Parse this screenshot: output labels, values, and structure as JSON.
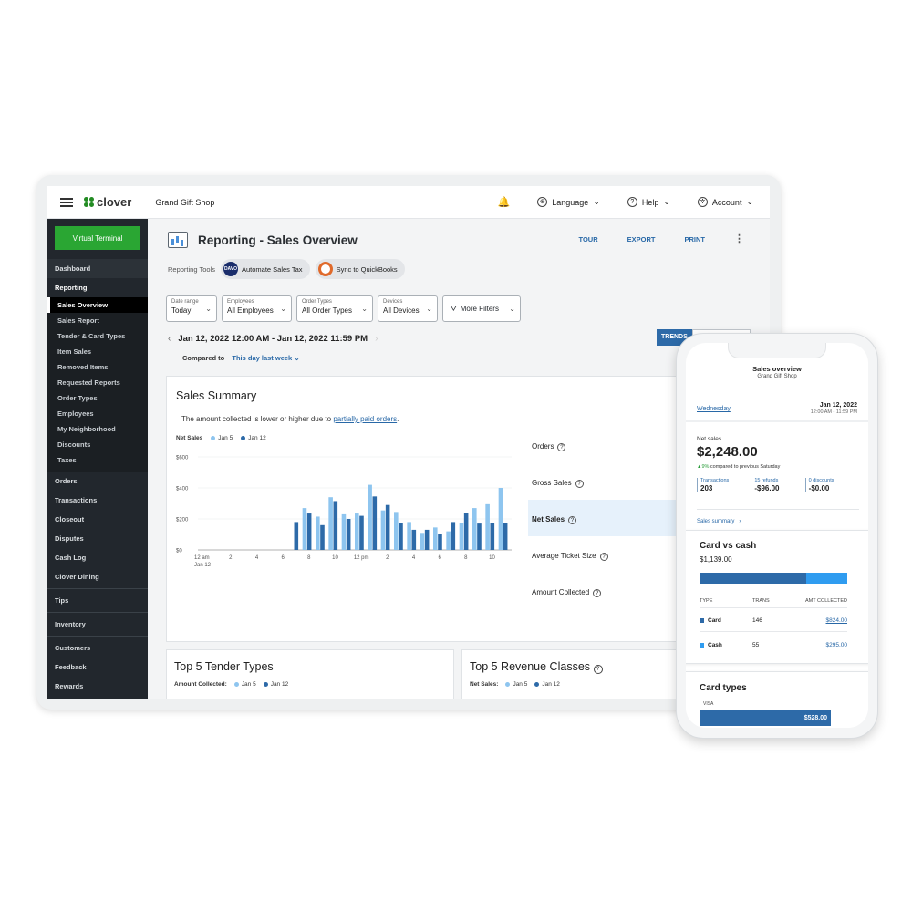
{
  "topbar": {
    "brand": "clover",
    "shop_name": "Grand Gift Shop",
    "language_label": "Language",
    "help_label": "Help",
    "account_label": "Account"
  },
  "sidebar": {
    "virtual_terminal": "Virtual Terminal",
    "dashboard": "Dashboard",
    "reporting": "Reporting",
    "reporting_items": [
      "Sales Overview",
      "Sales Report",
      "Tender & Card Types",
      "Item Sales",
      "Removed Items",
      "Requested Reports",
      "Order Types",
      "Employees",
      "My Neighborhood",
      "Discounts",
      "Taxes"
    ],
    "section_one": [
      "Orders",
      "Transactions",
      "Closeout",
      "Disputes",
      "Cash Log",
      "Clover Dining"
    ],
    "section_two": [
      "Tips"
    ],
    "section_three": [
      "Inventory"
    ],
    "section_four": [
      "Customers",
      "Feedback",
      "Rewards"
    ]
  },
  "header": {
    "title": "Reporting - Sales Overview",
    "tour": "TOUR",
    "export": "EXPORT",
    "print": "PRINT",
    "kebab": "⋮"
  },
  "tools": {
    "label": "Reporting Tools",
    "davo_badge": "DAVO",
    "automate_tax": "Automate Sales Tax",
    "quickbooks": "Sync to QuickBooks"
  },
  "filters": [
    {
      "label": "Date range",
      "value": "Today"
    },
    {
      "label": "Employees",
      "value": "All Employees"
    },
    {
      "label": "Order Types",
      "value": "All Order Types"
    },
    {
      "label": "Devices",
      "value": "All Devices"
    }
  ],
  "more_filters": "More Filters",
  "date_range": "Jan 12, 2022 12:00 AM - Jan 12, 2022 11:59 PM",
  "compare": {
    "label": "Compared to",
    "value": "This day last week"
  },
  "trends_tab": "TRENDS",
  "summary": {
    "title": "Sales Summary",
    "note_prefix": "The amount collected is lower or higher due to ",
    "note_link": "partially paid orders",
    "note_suffix": ".",
    "legend_title": "Net Sales",
    "legend_series_a": "Jan 5",
    "legend_series_b": "Jan 12"
  },
  "chart_data": {
    "type": "bar",
    "ylim": [
      0,
      600
    ],
    "yticks": [
      "$0",
      "$200",
      "$400",
      "$600"
    ],
    "ytick_values": [
      0,
      200,
      400,
      600
    ],
    "xticks": [
      "12 am",
      "2",
      "4",
      "6",
      "8",
      "10",
      "12 pm",
      "2",
      "4",
      "6",
      "8",
      "10"
    ],
    "xtick_sub": "Jan 12",
    "categories": [
      "7",
      "8",
      "9",
      "10",
      "11",
      "12",
      "13",
      "14",
      "15",
      "16",
      "17",
      "18",
      "19",
      "20",
      "21",
      "22",
      "23"
    ],
    "series": [
      {
        "name": "Jan 5",
        "color": "#8ec5ef",
        "values": [
          0,
          270,
          215,
          340,
          230,
          235,
          420,
          255,
          245,
          180,
          110,
          145,
          120,
          175,
          270,
          295,
          400
        ]
      },
      {
        "name": "Jan 12",
        "color": "#2d6aa8",
        "values": [
          180,
          235,
          160,
          315,
          200,
          220,
          345,
          290,
          175,
          130,
          130,
          100,
          180,
          240,
          170,
          175,
          175
        ]
      }
    ]
  },
  "metrics": [
    {
      "label": "Orders",
      "active": false,
      "caret": false
    },
    {
      "label": "Gross Sales",
      "active": false,
      "caret": true
    },
    {
      "label": "Net Sales",
      "active": true,
      "caret": true
    },
    {
      "label": "Average Ticket Size",
      "active": false,
      "caret": false
    },
    {
      "label": "Amount Collected",
      "active": false,
      "caret": true
    }
  ],
  "metric_caret": "▾",
  "help_glyph": "?",
  "tender_card": {
    "title": "Top 5 Tender Types",
    "legend_label": "Amount Collected:",
    "series_a": "Jan 5",
    "series_b": "Jan 12"
  },
  "revenue_card": {
    "title": "Top 5 Revenue Classes",
    "legend_label": "Net Sales:",
    "series_a": "Jan 5",
    "series_b": "Jan 12"
  },
  "phone": {
    "title": "Sales overview",
    "shop": "Grand Gift Shop",
    "day": "Wednesday",
    "date": "Jan 12, 2022",
    "time": "12:00 AM - 11:59 PM",
    "net_sales_label": "Net sales",
    "net_sales_value": "$2,248.00",
    "compare_pct": "▲9%",
    "compare_text": " compared to previous Saturday",
    "stats": [
      {
        "label": "Transactions",
        "value": "203"
      },
      {
        "label": "15 refunds",
        "value": "-$96.00"
      },
      {
        "label": "0 discounts",
        "value": "-$0.00"
      }
    ],
    "summary_link": "Sales summary",
    "summary_arrow": "›",
    "card_vs_cash": {
      "title": "Card vs cash",
      "total": "$1,139.00",
      "card_fraction": 0.72,
      "col_type": "TYPE",
      "col_trans": "TRANS",
      "col_amount": "AMT COLLECTED",
      "rows": [
        {
          "type": "Card",
          "trans": "146",
          "amount": "$824.00",
          "color": "#2d6aa8"
        },
        {
          "type": "Cash",
          "trans": "55",
          "amount": "$295.00",
          "color": "#2f9cf0"
        }
      ]
    },
    "card_types": {
      "title": "Card types",
      "visa_label": "VISA",
      "visa_amount": "$528.00"
    }
  }
}
